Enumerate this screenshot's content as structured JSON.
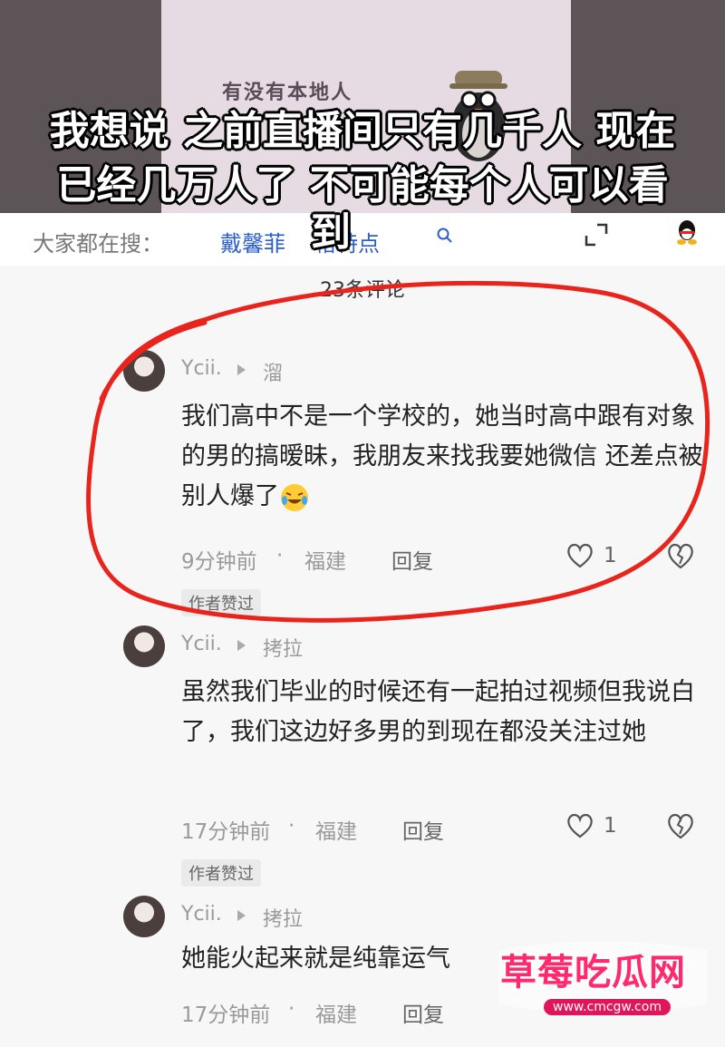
{
  "video": {
    "sign_text": "有没有本地人",
    "caption_line1": "我想说 之前直播间只有几千人 现在",
    "caption_line2": "已经几万人了  不可能每个人可以看",
    "caption_line3": "到"
  },
  "search": {
    "prefix": "大家都在搜：",
    "term": "戴馨菲",
    "term_suffix": "格特点"
  },
  "comments_header": {
    "count_label": "23条评论"
  },
  "comments": [
    {
      "user": "Ycii.",
      "source": "溜",
      "text": "我们高中不是一个学校的，她当时高中跟有对象的男的搞暧昧，我朋友来找我要她微信 还差点被别人爆了",
      "time": "9分钟前",
      "location": "福建",
      "reply_label": "回复",
      "likes": "1",
      "badge": "作者赞过"
    },
    {
      "user": "Ycii.",
      "source": "拷拉",
      "text": "虽然我们毕业的时候还有一起拍过视频但我说白了，我们这边好多男的到现在都没关注过她",
      "time": "17分钟前",
      "location": "福建",
      "reply_label": "回复",
      "likes": "1",
      "badge": "作者赞过"
    },
    {
      "user": "Ycii.",
      "source": "拷拉",
      "text": "她能火起来就是纯靠运气",
      "time": "17分钟前",
      "location": "福建",
      "reply_label": "回复",
      "likes": "",
      "badge": ""
    }
  ],
  "watermark": {
    "title": "草莓吃瓜网",
    "url": "www.cmcgw.com"
  },
  "colors": {
    "highlight": "#e8241c",
    "link": "#2b5fc9",
    "watermark": "#ff2a6d"
  },
  "icons": [
    "search-icon",
    "expand-icon",
    "qq-icon",
    "play-icon",
    "heart-icon",
    "broken-heart-icon",
    "laugh-cry-emoji"
  ]
}
